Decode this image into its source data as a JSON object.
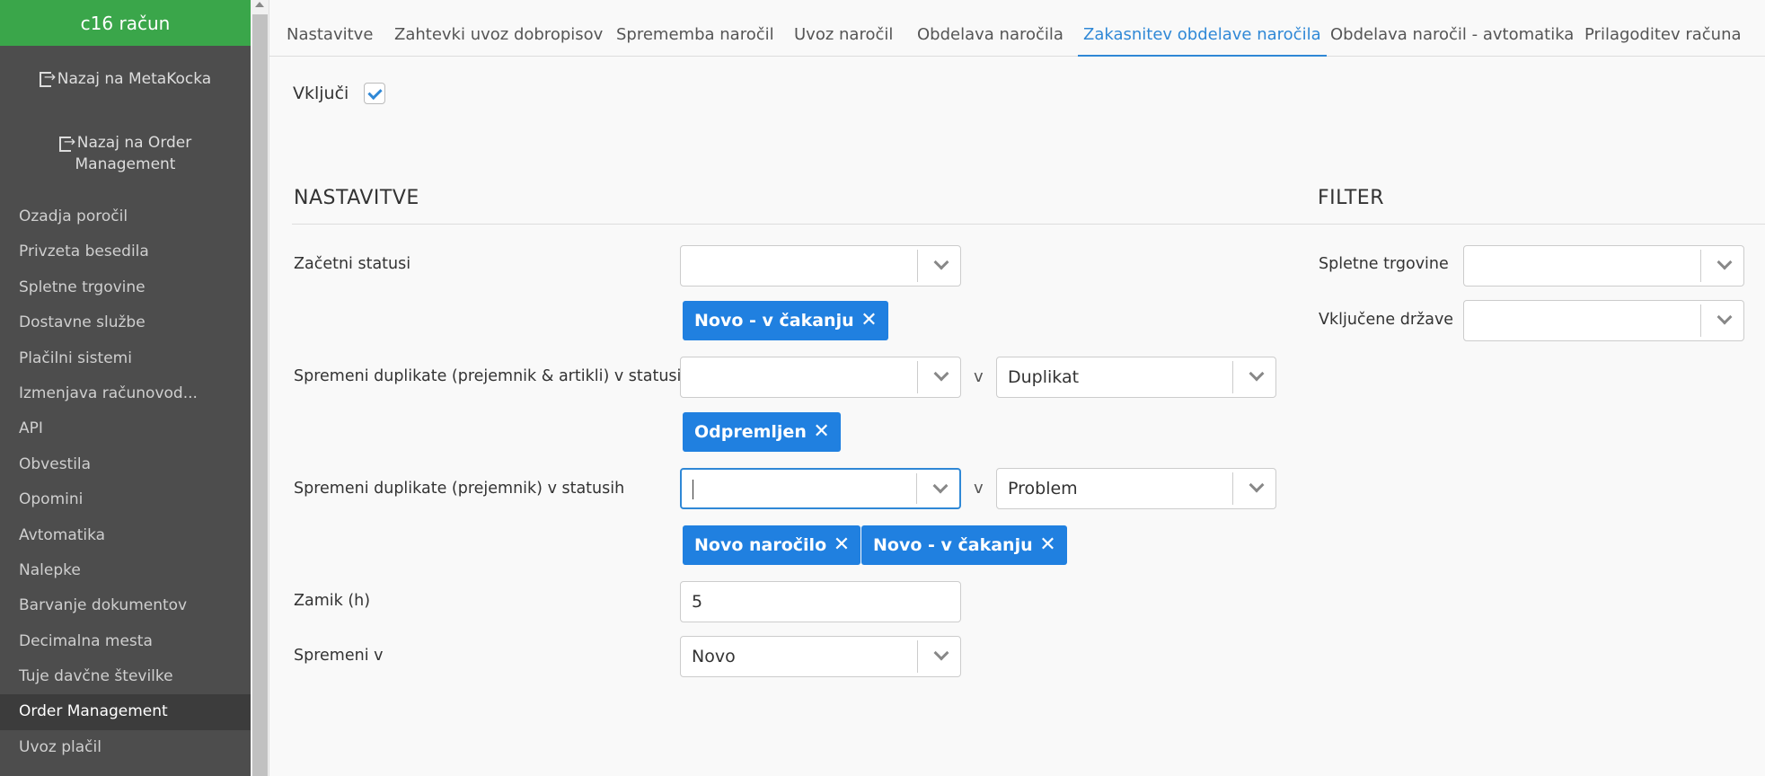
{
  "sidebar": {
    "brand": "c16 račun",
    "back_metakocka": "Nazaj na MetaKocka",
    "back_order_line1": "Nazaj na Order",
    "back_order_line2": "Management",
    "items": [
      {
        "label": "Ozadja poročil"
      },
      {
        "label": "Privzeta besedila"
      },
      {
        "label": "Spletne trgovine"
      },
      {
        "label": "Dostavne službe"
      },
      {
        "label": "Plačilni sistemi"
      },
      {
        "label": "Izmenjava računovod..."
      },
      {
        "label": "API"
      },
      {
        "label": "Obvestila"
      },
      {
        "label": "Opomini"
      },
      {
        "label": "Avtomatika"
      },
      {
        "label": "Nalepke"
      },
      {
        "label": "Barvanje dokumentov"
      },
      {
        "label": "Decimalna mesta"
      },
      {
        "label": "Tuje davčne številke"
      },
      {
        "label": "Order Management"
      },
      {
        "label": "Uvoz plačil"
      }
    ]
  },
  "tabs": [
    {
      "label": "Nastavitve"
    },
    {
      "label": "Zahtevki uvoz dobropisov"
    },
    {
      "label": "Sprememba naročil"
    },
    {
      "label": "Uvoz naročil"
    },
    {
      "label": "Obdelava naročila"
    },
    {
      "label": "Zakasnitev obdelave naročila"
    },
    {
      "label": "Obdelava naročil - avtomatika"
    },
    {
      "label": "Prilagoditev računa"
    }
  ],
  "enable": {
    "label": "Vključi",
    "checked": true
  },
  "settings": {
    "title": "NASTAVITVE",
    "start_statuses_label": "Začetni statusi",
    "start_statuses_tags": [
      "Novo - v čakanju"
    ],
    "dup_full_label": "Spremeni duplikate (prejemnik & artikli) v statusih",
    "dup_full_target": "Duplikat",
    "dup_full_tags": [
      "Odpremljen"
    ],
    "dup_recipient_label": "Spremeni duplikate (prejemnik) v statusih",
    "dup_recipient_target": "Problem",
    "dup_recipient_tags": [
      "Novo naročilo",
      "Novo - v čakanju"
    ],
    "v_label": "v",
    "delay_label": "Zamik (h)",
    "delay_value": "5",
    "change_to_label": "Spremeni v",
    "change_to_value": "Novo"
  },
  "filter": {
    "title": "FILTER",
    "webshops_label": "Spletne trgovine",
    "countries_label": "Vključene države"
  },
  "colors": {
    "accent": "#2080e0",
    "brand": "#3aa64a",
    "sidebar": "#4d4d4d"
  }
}
